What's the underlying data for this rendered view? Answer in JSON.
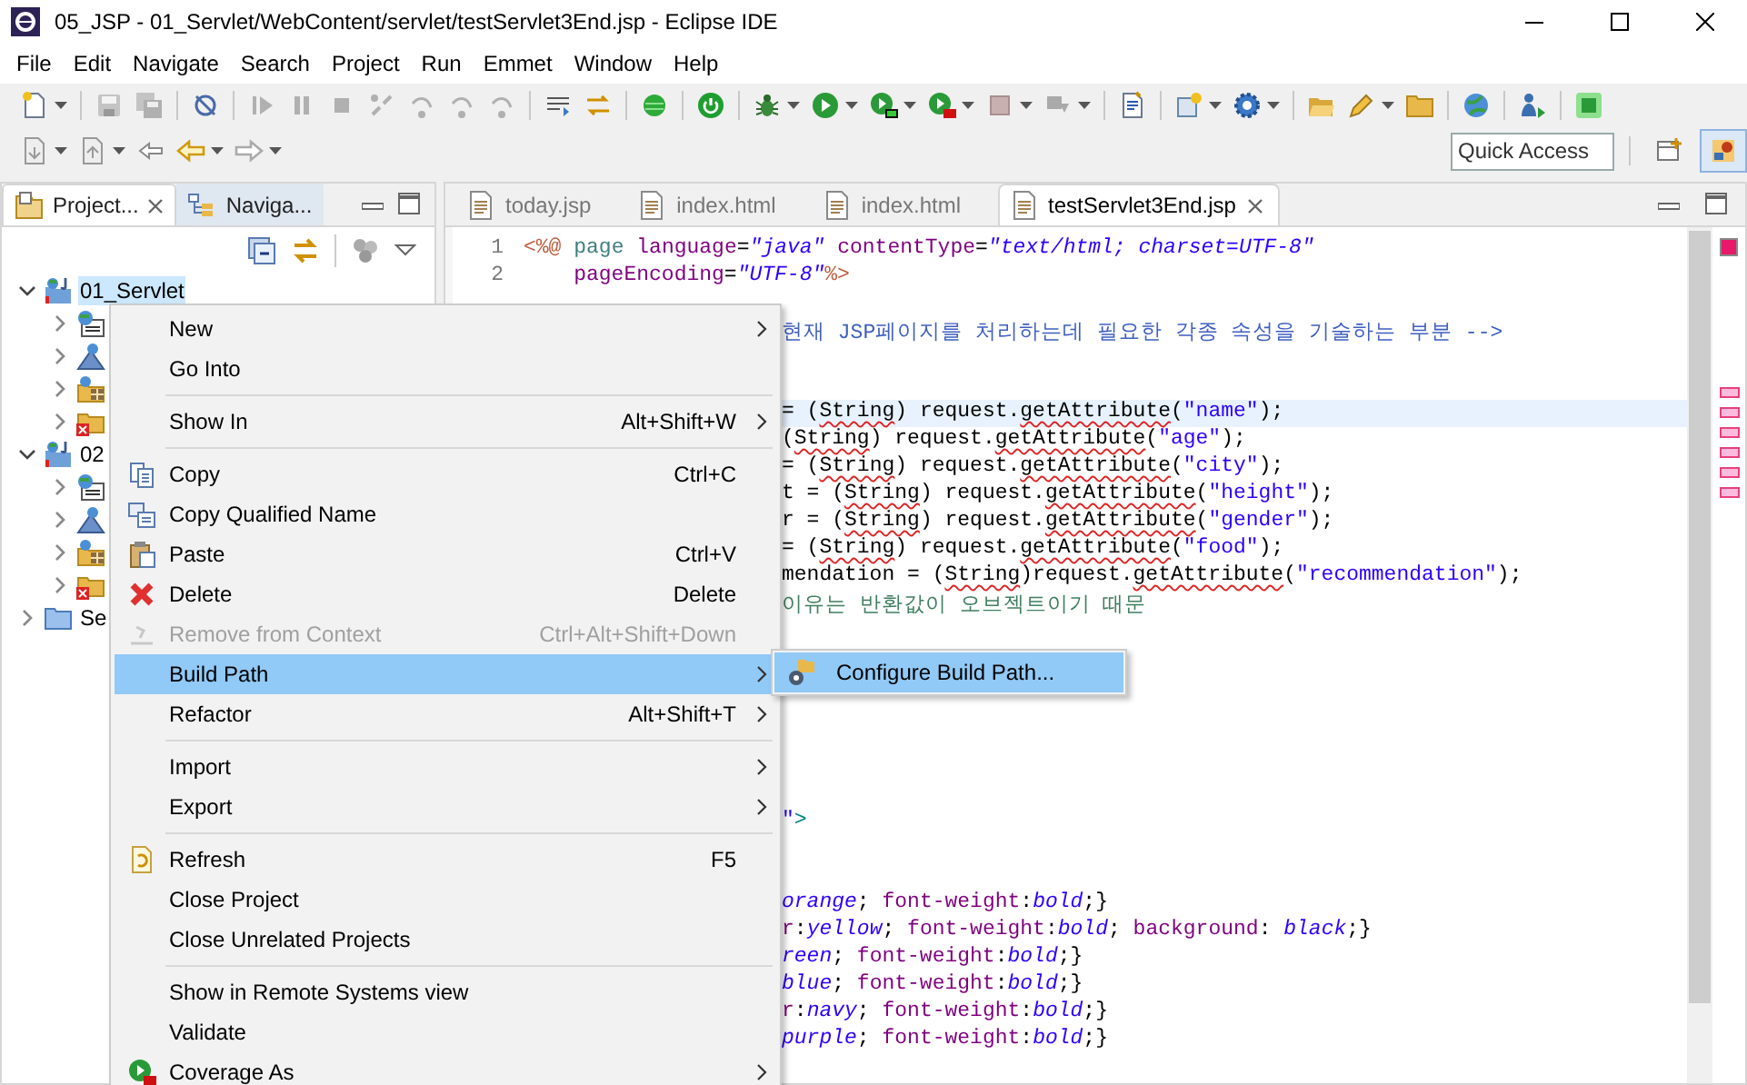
{
  "window": {
    "title": "05_JSP - 01_Servlet/WebContent/servlet/testServlet3End.jsp - Eclipse IDE"
  },
  "menu_bar": [
    "File",
    "Edit",
    "Navigate",
    "Search",
    "Project",
    "Run",
    "Emmet",
    "Window",
    "Help"
  ],
  "quick_access": {
    "placeholder": "Quick Access"
  },
  "perspectives": [
    {
      "selected": false
    },
    {
      "selected": true
    }
  ],
  "project_explorer": {
    "tabs": [
      {
        "label": "Project...",
        "selected": true
      },
      {
        "label": "Naviga...",
        "selected": false
      }
    ],
    "tree": [
      {
        "kind": "project",
        "label": "01_Servlet",
        "expanded": true,
        "selected": true,
        "children": [
          {
            "kind": "deployment",
            "expanded": false
          },
          {
            "kind": "services",
            "expanded": false
          },
          {
            "kind": "resources",
            "expanded": false
          },
          {
            "kind": "error-folder",
            "expanded": false
          }
        ]
      },
      {
        "kind": "project",
        "label": "02",
        "expanded": true,
        "selected": false,
        "children": [
          {
            "kind": "deployment",
            "expanded": false
          },
          {
            "kind": "services",
            "expanded": false
          },
          {
            "kind": "resources",
            "expanded": false
          },
          {
            "kind": "error-folder",
            "expanded": false
          }
        ]
      },
      {
        "kind": "folder",
        "label": "Se",
        "expanded": false,
        "selected": false
      }
    ]
  },
  "editor": {
    "tabs": [
      {
        "label": "today.jsp",
        "selected": false
      },
      {
        "label": "index.html",
        "selected": false
      },
      {
        "label": "index.html",
        "selected": false
      },
      {
        "label": "testServlet3End.jsp",
        "selected": true
      }
    ],
    "lines": [
      {
        "kind": "code",
        "number": "1",
        "current": false,
        "segments": [
          {
            "kind": "tag",
            "text": "<%@"
          },
          {
            "kind": "keyword",
            "text": " page"
          },
          {
            "kind": "attr",
            "text": " language"
          },
          {
            "kind": "plain",
            "text": "="
          },
          {
            "kind": "value",
            "text": "\"java\""
          },
          {
            "kind": "attr",
            "text": " contentType"
          },
          {
            "kind": "plain",
            "text": "="
          },
          {
            "kind": "value",
            "text": "\"text/html; charset=UTF-8\""
          }
        ]
      },
      {
        "kind": "code",
        "number": "2",
        "current": false,
        "segments": [
          {
            "kind": "attr",
            "text": "    pageEncoding"
          },
          {
            "kind": "plain",
            "text": "="
          },
          {
            "kind": "value",
            "text": "\"UTF-8\""
          },
          {
            "kind": "tag",
            "text": "%>"
          }
        ]
      },
      {
        "kind": "empty",
        "current": false
      },
      {
        "kind": "covered",
        "current": false,
        "segments": [
          {
            "kind": "comment",
            "text": "현재 JSP페이지를 처리하는데 필요한 각종 속성을 기술하는 부분 -->"
          }
        ]
      },
      {
        "kind": "empty",
        "current": false
      },
      {
        "kind": "empty",
        "current": false
      },
      {
        "kind": "covered",
        "current": true,
        "segments": [
          {
            "kind": "plain",
            "text": "= ("
          },
          {
            "kind": "err",
            "text": "String"
          },
          {
            "kind": "plain",
            "text": ") request."
          },
          {
            "kind": "err",
            "text": "getAttribute"
          },
          {
            "kind": "plain",
            "text": "("
          },
          {
            "kind": "string",
            "text": "\"name\""
          },
          {
            "kind": "plain",
            "text": ");"
          }
        ]
      },
      {
        "kind": "covered",
        "current": false,
        "segments": [
          {
            "kind": "plain",
            "text": "("
          },
          {
            "kind": "err",
            "text": "String"
          },
          {
            "kind": "plain",
            "text": ") request."
          },
          {
            "kind": "err",
            "text": "getAttribute"
          },
          {
            "kind": "plain",
            "text": "("
          },
          {
            "kind": "string",
            "text": "\"age\""
          },
          {
            "kind": "plain",
            "text": ");"
          }
        ]
      },
      {
        "kind": "covered",
        "current": false,
        "segments": [
          {
            "kind": "plain",
            "text": "= ("
          },
          {
            "kind": "err",
            "text": "String"
          },
          {
            "kind": "plain",
            "text": ") request."
          },
          {
            "kind": "err",
            "text": "getAttribute"
          },
          {
            "kind": "plain",
            "text": "("
          },
          {
            "kind": "string",
            "text": "\"city\""
          },
          {
            "kind": "plain",
            "text": ");"
          }
        ]
      },
      {
        "kind": "covered",
        "current": false,
        "segments": [
          {
            "kind": "plain",
            "text": "t = ("
          },
          {
            "kind": "err",
            "text": "String"
          },
          {
            "kind": "plain",
            "text": ") request."
          },
          {
            "kind": "err",
            "text": "getAttribute"
          },
          {
            "kind": "plain",
            "text": "("
          },
          {
            "kind": "string",
            "text": "\"height\""
          },
          {
            "kind": "plain",
            "text": ");"
          }
        ]
      },
      {
        "kind": "covered",
        "current": false,
        "segments": [
          {
            "kind": "plain",
            "text": "r = ("
          },
          {
            "kind": "err",
            "text": "String"
          },
          {
            "kind": "plain",
            "text": ") request."
          },
          {
            "kind": "err",
            "text": "getAttribute"
          },
          {
            "kind": "plain",
            "text": "("
          },
          {
            "kind": "string",
            "text": "\"gender\""
          },
          {
            "kind": "plain",
            "text": ");"
          }
        ]
      },
      {
        "kind": "covered",
        "current": false,
        "segments": [
          {
            "kind": "plain",
            "text": "= ("
          },
          {
            "kind": "err",
            "text": "String"
          },
          {
            "kind": "plain",
            "text": ") request."
          },
          {
            "kind": "err",
            "text": "getAttribute"
          },
          {
            "kind": "plain",
            "text": "("
          },
          {
            "kind": "string",
            "text": "\"food\""
          },
          {
            "kind": "plain",
            "text": ");"
          }
        ]
      },
      {
        "kind": "covered",
        "current": false,
        "segments": [
          {
            "kind": "plain",
            "text": "mendation = ("
          },
          {
            "kind": "err",
            "text": "String"
          },
          {
            "kind": "plain",
            "text": ")request."
          },
          {
            "kind": "err",
            "text": "getAttribute"
          },
          {
            "kind": "plain",
            "text": "("
          },
          {
            "kind": "string",
            "text": "\"recommendation\""
          },
          {
            "kind": "plain",
            "text": ");"
          }
        ]
      },
      {
        "kind": "covered",
        "current": false,
        "segments": [
          {
            "kind": "note",
            "text": "이유는 반환값이 오브젝트이기 때문"
          }
        ]
      },
      {
        "kind": "empty",
        "current": false
      },
      {
        "kind": "empty",
        "current": false
      },
      {
        "kind": "empty",
        "current": false
      },
      {
        "kind": "empty",
        "current": false
      },
      {
        "kind": "empty",
        "current": false
      },
      {
        "kind": "empty",
        "current": false
      },
      {
        "kind": "empty",
        "current": false
      },
      {
        "kind": "covered",
        "current": false,
        "segments": [
          {
            "kind": "string",
            "text": "\""
          },
          {
            "kind": "close",
            "text": ">"
          }
        ]
      },
      {
        "kind": "empty",
        "current": false
      },
      {
        "kind": "empty",
        "current": false
      },
      {
        "kind": "covered",
        "current": false,
        "segments": [
          {
            "kind": "value",
            "text": "orange"
          },
          {
            "kind": "plain",
            "text": "; "
          },
          {
            "kind": "attr",
            "text": "font-weight"
          },
          {
            "kind": "plain",
            "text": ":"
          },
          {
            "kind": "value",
            "text": "bold"
          },
          {
            "kind": "plain",
            "text": ";}"
          }
        ]
      },
      {
        "kind": "covered",
        "current": false,
        "segments": [
          {
            "kind": "attr",
            "text": "r"
          },
          {
            "kind": "plain",
            "text": ":"
          },
          {
            "kind": "value",
            "text": "yellow"
          },
          {
            "kind": "plain",
            "text": "; "
          },
          {
            "kind": "attr",
            "text": "font-weight"
          },
          {
            "kind": "plain",
            "text": ":"
          },
          {
            "kind": "value",
            "text": "bold"
          },
          {
            "kind": "plain",
            "text": "; "
          },
          {
            "kind": "attr",
            "text": "background"
          },
          {
            "kind": "plain",
            "text": ": "
          },
          {
            "kind": "value",
            "text": "black"
          },
          {
            "kind": "plain",
            "text": ";}"
          }
        ]
      },
      {
        "kind": "covered",
        "current": false,
        "segments": [
          {
            "kind": "value",
            "text": "reen"
          },
          {
            "kind": "plain",
            "text": "; "
          },
          {
            "kind": "attr",
            "text": "font-weight"
          },
          {
            "kind": "plain",
            "text": ":"
          },
          {
            "kind": "value",
            "text": "bold"
          },
          {
            "kind": "plain",
            "text": ";}"
          }
        ]
      },
      {
        "kind": "covered",
        "current": false,
        "segments": [
          {
            "kind": "value",
            "text": "blue"
          },
          {
            "kind": "plain",
            "text": "; "
          },
          {
            "kind": "attr",
            "text": "font-weight"
          },
          {
            "kind": "plain",
            "text": ":"
          },
          {
            "kind": "value",
            "text": "bold"
          },
          {
            "kind": "plain",
            "text": ";}"
          }
        ]
      },
      {
        "kind": "covered",
        "current": false,
        "segments": [
          {
            "kind": "attr",
            "text": "r"
          },
          {
            "kind": "plain",
            "text": ":"
          },
          {
            "kind": "value",
            "text": "navy"
          },
          {
            "kind": "plain",
            "text": "; "
          },
          {
            "kind": "attr",
            "text": "font-weight"
          },
          {
            "kind": "plain",
            "text": ":"
          },
          {
            "kind": "value",
            "text": "bold"
          },
          {
            "kind": "plain",
            "text": ";}"
          }
        ]
      },
      {
        "kind": "covered",
        "current": false,
        "segments": [
          {
            "kind": "value",
            "text": "purple"
          },
          {
            "kind": "plain",
            "text": "; "
          },
          {
            "kind": "attr",
            "text": "font-weight"
          },
          {
            "kind": "plain",
            "text": ":"
          },
          {
            "kind": "value",
            "text": "bold"
          },
          {
            "kind": "plain",
            "text": ";}"
          }
        ]
      }
    ]
  },
  "context_menu": {
    "items": [
      {
        "kind": "item",
        "label": "New",
        "submenu": true,
        "disabled": false,
        "selected": false
      },
      {
        "kind": "item",
        "label": "Go Into",
        "submenu": false,
        "disabled": false,
        "selected": false
      },
      {
        "kind": "separator"
      },
      {
        "kind": "item",
        "label": "Show In",
        "shortcut": "Alt+Shift+W",
        "submenu": true,
        "disabled": false,
        "selected": false
      },
      {
        "kind": "separator"
      },
      {
        "kind": "item",
        "label": "Copy",
        "shortcut": "Ctrl+C",
        "submenu": false,
        "disabled": false,
        "selected": false
      },
      {
        "kind": "item",
        "label": "Copy Qualified Name",
        "submenu": false,
        "disabled": false,
        "selected": false
      },
      {
        "kind": "item",
        "label": "Paste",
        "shortcut": "Ctrl+V",
        "submenu": false,
        "disabled": false,
        "selected": false
      },
      {
        "kind": "item",
        "label": "Delete",
        "shortcut": "Delete",
        "submenu": false,
        "disabled": false,
        "selected": false
      },
      {
        "kind": "item",
        "label": "Remove from Context",
        "shortcut": "Ctrl+Alt+Shift+Down",
        "submenu": false,
        "disabled": true,
        "selected": false
      },
      {
        "kind": "item",
        "label": "Build Path",
        "submenu": true,
        "disabled": false,
        "selected": true
      },
      {
        "kind": "item",
        "label": "Refactor",
        "shortcut": "Alt+Shift+T",
        "submenu": true,
        "disabled": false,
        "selected": false
      },
      {
        "kind": "separator"
      },
      {
        "kind": "item",
        "label": "Import",
        "submenu": true,
        "disabled": false,
        "selected": false
      },
      {
        "kind": "item",
        "label": "Export",
        "submenu": true,
        "disabled": false,
        "selected": false
      },
      {
        "kind": "separator"
      },
      {
        "kind": "item",
        "label": "Refresh",
        "shortcut": "F5",
        "submenu": false,
        "disabled": false,
        "selected": false
      },
      {
        "kind": "item",
        "label": "Close Project",
        "submenu": false,
        "disabled": false,
        "selected": false
      },
      {
        "kind": "item",
        "label": "Close Unrelated Projects",
        "submenu": false,
        "disabled": false,
        "selected": false
      },
      {
        "kind": "separator"
      },
      {
        "kind": "item",
        "label": "Show in Remote Systems view",
        "submenu": false,
        "disabled": false,
        "selected": false
      },
      {
        "kind": "item",
        "label": "Validate",
        "submenu": false,
        "disabled": false,
        "selected": false
      },
      {
        "kind": "item",
        "label": "Coverage As",
        "submenu": true,
        "disabled": false,
        "selected": false
      }
    ]
  },
  "submenu": {
    "items": [
      {
        "label": "Configure Build Path...",
        "selected": true
      }
    ]
  }
}
